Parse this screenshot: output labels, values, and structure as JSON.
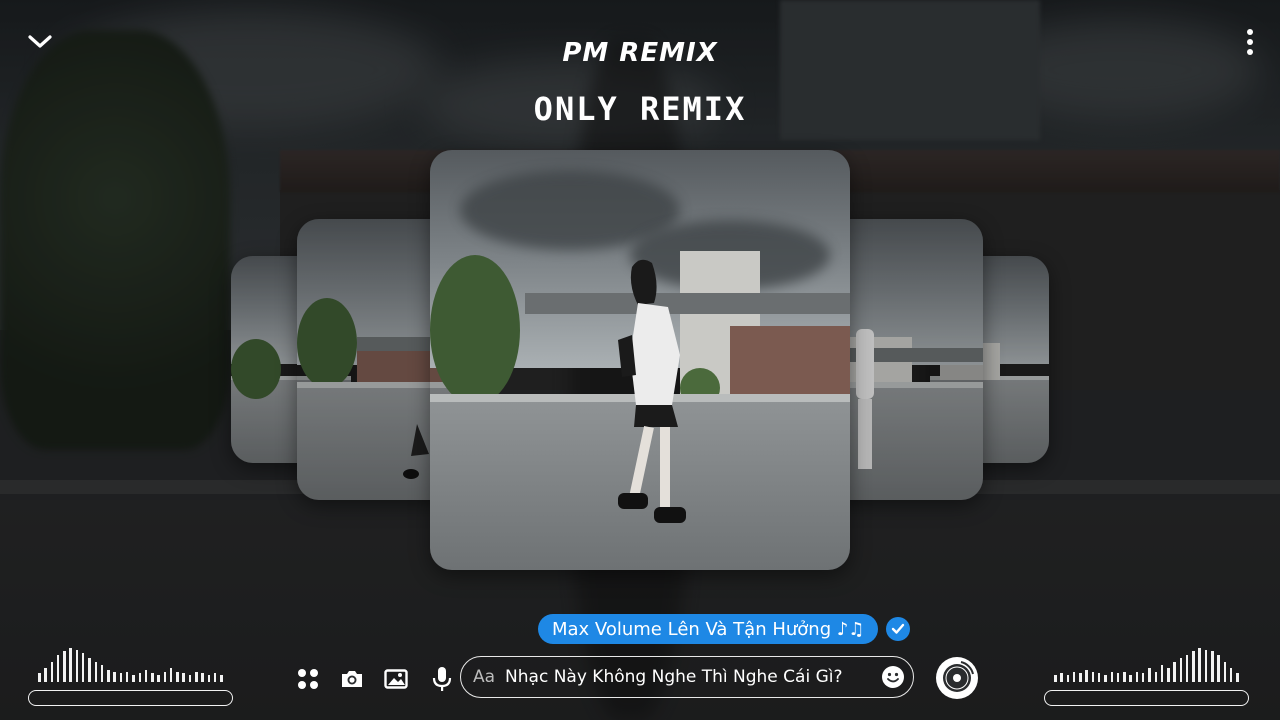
{
  "header": {
    "channel": "PM REMIX",
    "title": "ONLY REMIX"
  },
  "icons": {
    "collapse": "chevron-down-icon",
    "more": "more-vertical-icon",
    "apps": "apps-grid-icon",
    "camera": "camera-icon",
    "gallery": "image-icon",
    "mic": "mic-icon",
    "emoji": "smiley-icon",
    "disc": "music-disc-icon",
    "check": "check-circle-icon"
  },
  "message": {
    "text": "Max Volume Lên Và Tận Hưởng ♪♫",
    "color": "#1e88e5"
  },
  "composer": {
    "prefix": "Aa",
    "text": "Nhạc Này Không Nghe Thì Nghe Cái Gì?"
  },
  "visualizer_left": [
    0.25,
    0.4,
    0.6,
    0.8,
    0.9,
    1.0,
    0.95,
    0.85,
    0.7,
    0.6,
    0.5,
    0.35,
    0.3,
    0.25,
    0.3,
    0.2,
    0.25,
    0.35,
    0.25,
    0.2,
    0.3,
    0.4,
    0.3,
    0.25,
    0.2,
    0.3,
    0.25,
    0.2,
    0.25,
    0.2
  ],
  "visualizer_right": [
    0.2,
    0.25,
    0.2,
    0.3,
    0.25,
    0.35,
    0.3,
    0.25,
    0.2,
    0.3,
    0.25,
    0.3,
    0.2,
    0.3,
    0.25,
    0.4,
    0.3,
    0.5,
    0.4,
    0.6,
    0.7,
    0.8,
    0.9,
    1.0,
    0.95,
    0.9,
    0.8,
    0.6,
    0.4,
    0.25
  ]
}
